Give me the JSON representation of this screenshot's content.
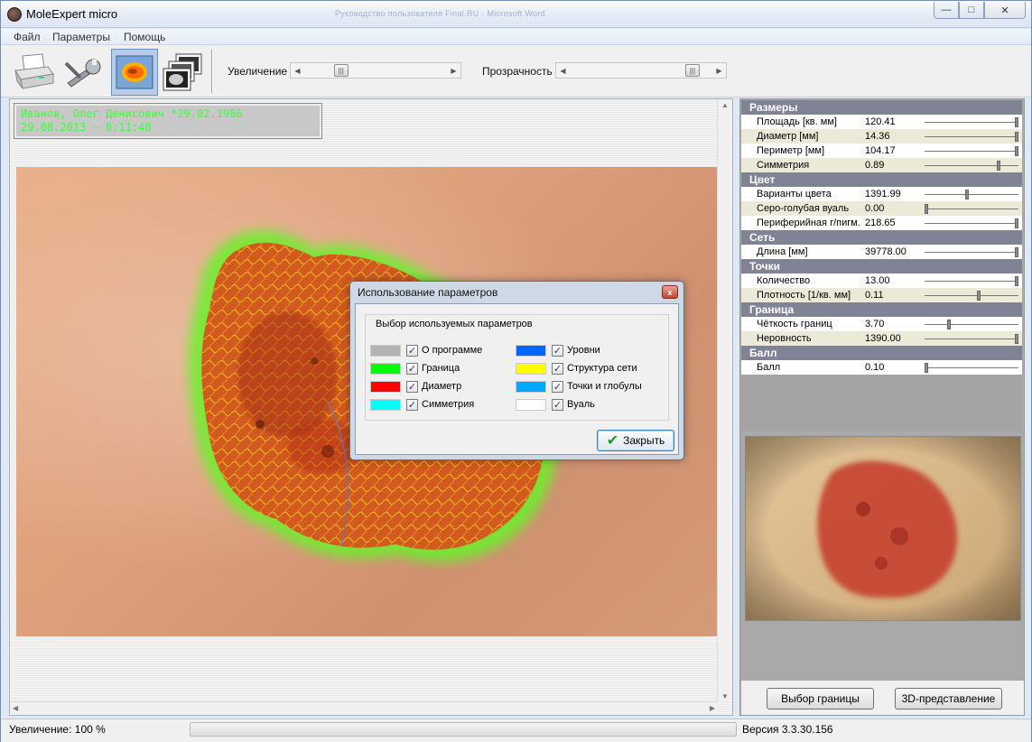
{
  "window": {
    "title": "MoleExpert micro",
    "ghost_text": "Руководство пользователя Final.RU · Microsoft Word",
    "controls": {
      "minimize": "—",
      "maximize": "□",
      "close": "✕"
    }
  },
  "menu": [
    "Файл",
    "Параметры",
    "Помощь"
  ],
  "toolbar": {
    "tools": [
      {
        "name": "printer-icon"
      },
      {
        "name": "wrench-icon"
      },
      {
        "name": "contour-image-icon",
        "active": true
      },
      {
        "name": "gallery-icon"
      }
    ],
    "zoom_label": "Увеличение",
    "zoom_level": 0.23,
    "transparency_label": "Прозрачность",
    "transparency_level": 0.92
  },
  "patient": {
    "line1": "Иванов, Олег Денисович  *29.02.1966",
    "line2": "29.08.2013 - 0:11:40"
  },
  "parameters": [
    {
      "section": "Размеры",
      "rows": [
        {
          "name": "Площадь [кв. мм]",
          "value": "120.41",
          "level": 1.0
        },
        {
          "name": "Диаметр [мм]",
          "value": "14.36",
          "level": 1.0
        },
        {
          "name": "Периметр [мм]",
          "value": "104.17",
          "level": 1.0
        },
        {
          "name": "Симметрия",
          "value": "0.89",
          "level": 0.8
        }
      ]
    },
    {
      "section": "Цвет",
      "rows": [
        {
          "name": "Варианты цвета",
          "value": "1391.99",
          "level": 0.45
        },
        {
          "name": "Серо-голубая вуаль",
          "value": "0.00",
          "level": 0.0
        },
        {
          "name": "Периферийная г/пигм.",
          "value": "218.65",
          "level": 1.0
        }
      ]
    },
    {
      "section": "Сеть",
      "rows": [
        {
          "name": "Длина [мм]",
          "value": "39778.00",
          "level": 1.0
        }
      ]
    },
    {
      "section": "Точки",
      "rows": [
        {
          "name": "Количество",
          "value": "13.00",
          "level": 1.0
        },
        {
          "name": "Плотность [1/кв. мм]",
          "value": "0.11",
          "level": 0.58
        }
      ]
    },
    {
      "section": "Граница",
      "rows": [
        {
          "name": "Чёткость границ",
          "value": "3.70",
          "level": 0.25
        },
        {
          "name": "Неровность",
          "value": "1390.00",
          "level": 1.0
        }
      ]
    },
    {
      "section": "Балл",
      "rows": [
        {
          "name": "Балл",
          "value": "0.10",
          "level": 0.0
        }
      ]
    }
  ],
  "buttons": {
    "border_select": "Выбор границы",
    "view_3d": "3D-представление"
  },
  "status": {
    "zoom": "Увеличение: 100 %",
    "version": "Версия 3.3.30.156"
  },
  "dialog": {
    "title": "Использование параметров",
    "close_glyph": "x",
    "group_title": "Выбор используемых параметров",
    "options": [
      {
        "label": "О программе",
        "color": "#b4b4b4",
        "checked": true
      },
      {
        "label": "Граница",
        "color": "#00ff00",
        "checked": true
      },
      {
        "label": "Диаметр",
        "color": "#ff0000",
        "checked": true
      },
      {
        "label": "Симметрия",
        "color": "#00ffff",
        "checked": true
      },
      {
        "label": "Уровни",
        "color": "#0066ff",
        "checked": true
      },
      {
        "label": "Структура сети",
        "color": "#ffff00",
        "checked": true
      },
      {
        "label": "Точки и глобулы",
        "color": "#00a8ff",
        "checked": true
      },
      {
        "label": "Вуаль",
        "color": "#ffffff",
        "checked": true
      }
    ],
    "check_glyph": "✓",
    "ok_glyph": "✔",
    "ok_label": "Закрыть"
  }
}
